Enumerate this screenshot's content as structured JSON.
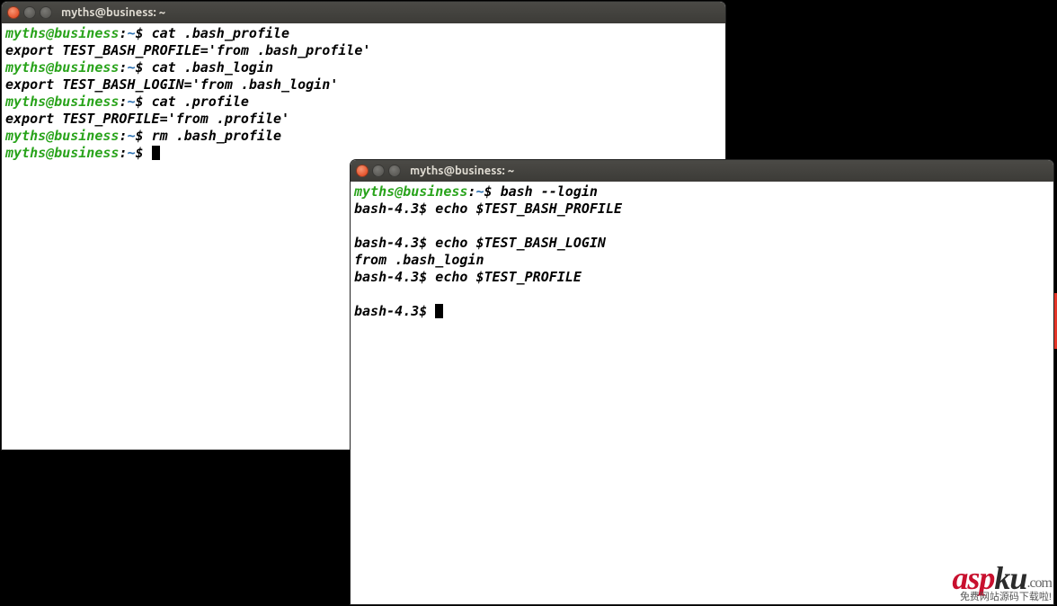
{
  "window1": {
    "title": "myths@business: ~",
    "prompt": {
      "userhost": "myths@business",
      "sep": ":",
      "path": "~",
      "sym": "$"
    },
    "lines": [
      {
        "type": "cmd",
        "text": "cat .bash_profile"
      },
      {
        "type": "out",
        "text": "export TEST_BASH_PROFILE='from .bash_profile'"
      },
      {
        "type": "cmd",
        "text": "cat .bash_login"
      },
      {
        "type": "out",
        "text": "export TEST_BASH_LOGIN='from .bash_login'"
      },
      {
        "type": "cmd",
        "text": "cat .profile"
      },
      {
        "type": "out",
        "text": "export TEST_PROFILE='from .profile'"
      },
      {
        "type": "cmd",
        "text": "rm .bash_profile"
      },
      {
        "type": "cmd-cursor",
        "text": ""
      }
    ]
  },
  "window2": {
    "title": "myths@business: ~",
    "prompt": {
      "userhost": "myths@business",
      "sep": ":",
      "path": "~",
      "sym": "$"
    },
    "subprompt": "bash-4.3$",
    "lines": [
      {
        "type": "cmd",
        "text": "bash --login"
      },
      {
        "type": "subcmd",
        "text": "echo $TEST_BASH_PROFILE"
      },
      {
        "type": "out",
        "text": ""
      },
      {
        "type": "subcmd",
        "text": "echo $TEST_BASH_LOGIN"
      },
      {
        "type": "out",
        "text": "from .bash_login"
      },
      {
        "type": "subcmd",
        "text": "echo $TEST_PROFILE"
      },
      {
        "type": "out",
        "text": ""
      },
      {
        "type": "sub-cursor",
        "text": ""
      }
    ]
  },
  "watermark": {
    "asp": "asp",
    "ku": "ku",
    "dot": ".com",
    "sub": "免费网站源码下载啦!"
  }
}
